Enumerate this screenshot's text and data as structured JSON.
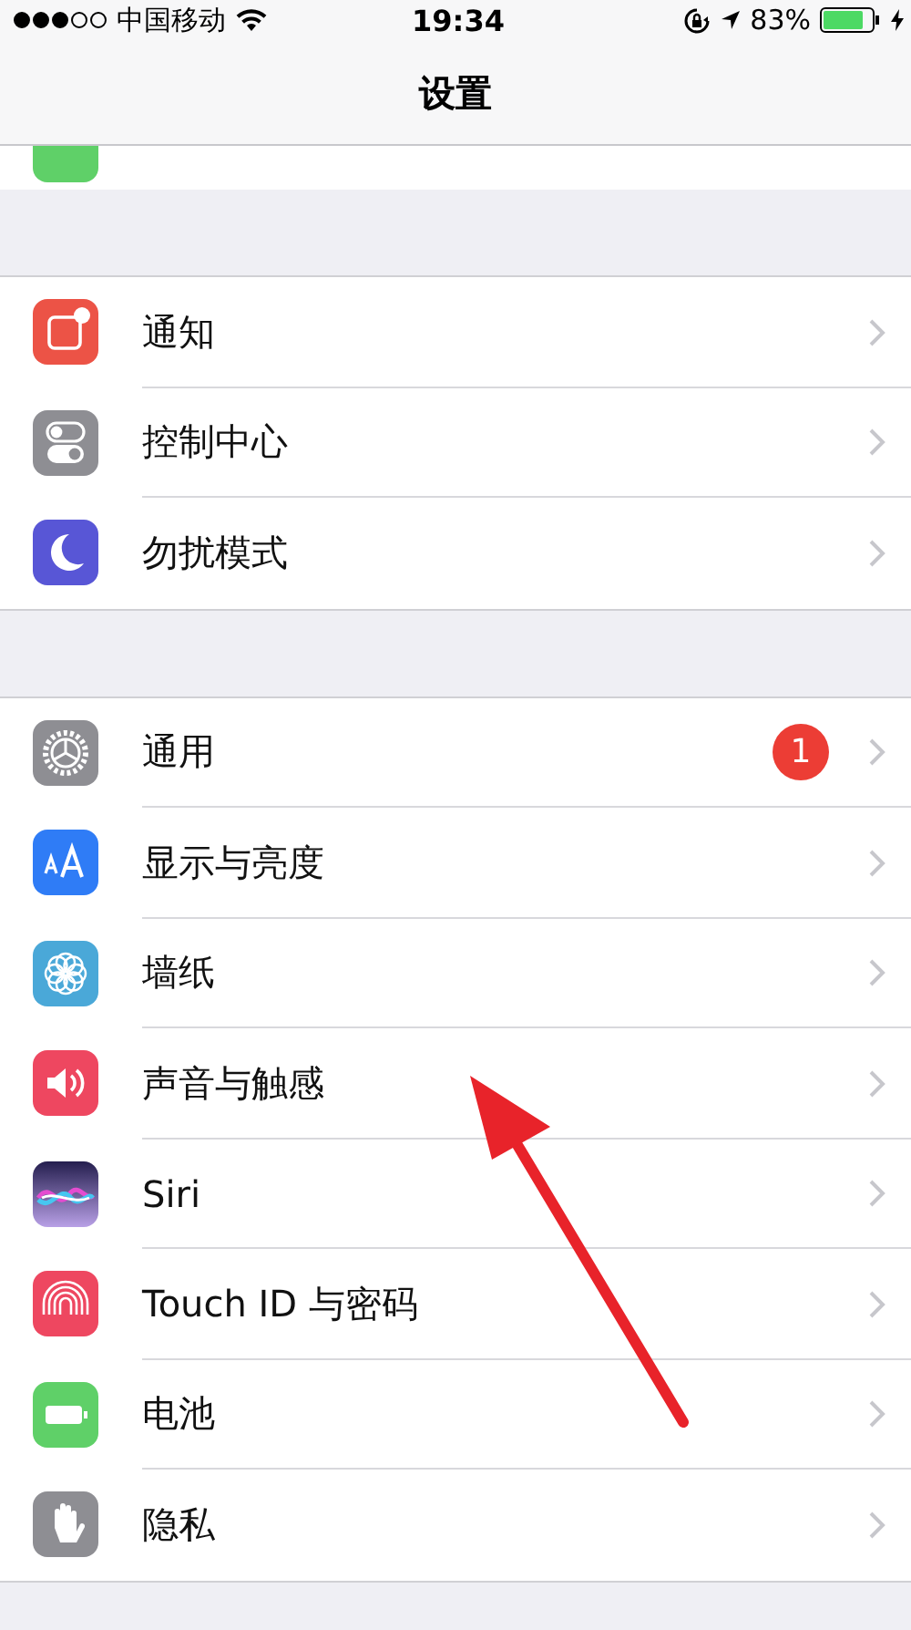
{
  "status_bar": {
    "carrier": "中国移动",
    "time": "19:34",
    "battery_text": "83%"
  },
  "nav": {
    "title": "设置"
  },
  "partial_row": {
    "kind": "cut"
  },
  "groups": [
    {
      "items": [
        {
          "kind": "notifications",
          "label": "通知"
        },
        {
          "kind": "control",
          "label": "控制中心"
        },
        {
          "kind": "moon",
          "label": "勿扰模式"
        }
      ]
    },
    {
      "items": [
        {
          "kind": "general",
          "label": "通用",
          "badge": "1"
        },
        {
          "kind": "display",
          "label": "显示与亮度"
        },
        {
          "kind": "wallpaper",
          "label": "墙纸"
        },
        {
          "kind": "sound",
          "label": "声音与触感"
        },
        {
          "kind": "siri",
          "label": "Siri"
        },
        {
          "kind": "touchid",
          "label": "Touch ID 与密码"
        },
        {
          "kind": "battery",
          "label": "电池"
        },
        {
          "kind": "privacy",
          "label": "隐私"
        }
      ]
    }
  ],
  "annotation": {
    "kind": "arrow"
  }
}
